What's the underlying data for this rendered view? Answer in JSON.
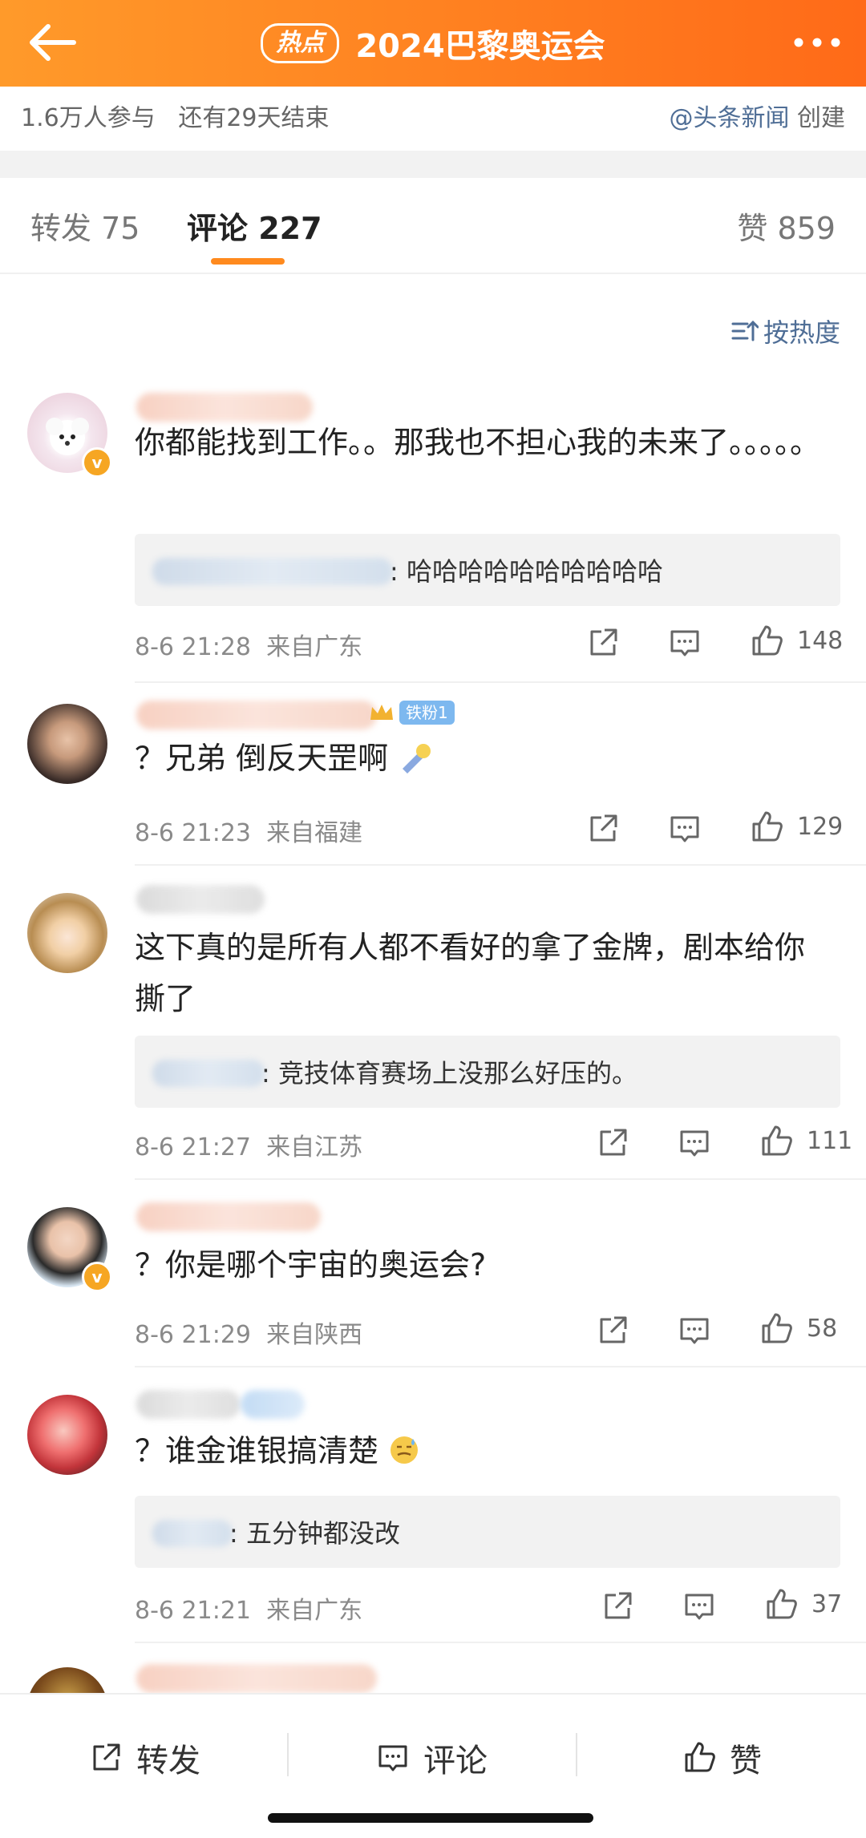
{
  "header": {
    "hot_label": "热点",
    "title": "2024巴黎奥运会"
  },
  "info": {
    "participants": "1.6万人参与",
    "remaining": "还有29天结束",
    "creator_handle": "@头条新闻",
    "creator_suffix": "创建"
  },
  "tabs": {
    "repost": "转发 75",
    "comment": "评论 227",
    "like": "赞 859"
  },
  "sort": {
    "label": "按热度"
  },
  "comments": [
    {
      "text": "你都能找到工作。。那我也不担心我的未来了。。。。。",
      "reply": ": 哈哈哈哈哈哈哈哈哈哈",
      "time": "8-6 21:28",
      "location": "来自广东",
      "likes": "148"
    },
    {
      "badge": "铁粉1",
      "text": "？兄弟 倒反天罡啊",
      "time": "8-6 21:23",
      "location": "来自福建",
      "likes": "129"
    },
    {
      "text": "这下真的是所有人都不看好的拿了金牌，剧本给你撕了",
      "reply": ": 竞技体育赛场上没那么好压的。",
      "time": "8-6 21:27",
      "location": "来自江苏",
      "likes": "111"
    },
    {
      "text": "？你是哪个宇宙的奥运会?",
      "time": "8-6 21:29",
      "location": "来自陕西",
      "likes": "58"
    },
    {
      "text": "？谁金谁银搞清楚",
      "reply": ": 五分钟都没改",
      "time": "8-6 21:21",
      "location": "来自广东",
      "likes": "37"
    }
  ],
  "bottom_bar": {
    "repost": "转发",
    "comment": "评论",
    "like": "赞"
  },
  "colors": {
    "header_start": "#ff9a2a",
    "header_end": "#ff6a18",
    "link_blue": "#4f6e96",
    "accent_orange": "#ff8a1e"
  }
}
